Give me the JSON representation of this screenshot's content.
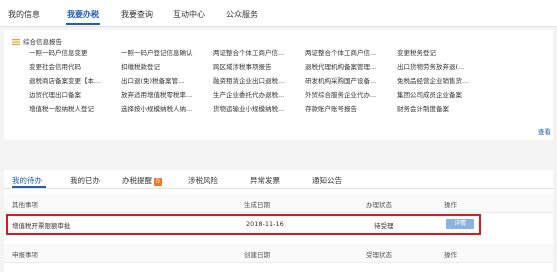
{
  "topnav": {
    "tabs": [
      "我的信息",
      "我要办税",
      "我要查询",
      "互动中心",
      "公众服务"
    ]
  },
  "report": {
    "title": "综合信息报告",
    "links": [
      [
        "一照一码户信息变更",
        "一照一码户登记信息确认",
        "两证整合个体工商户信...",
        "两证整合个体工商户信...",
        "变更税务登记"
      ],
      [
        "变更社会信用代码",
        "扣缴税款登记",
        "跨区域涉税事项报告",
        "退税代理机构备案管理...",
        "出口货物劳务放弃退(..."
      ],
      [
        "退税商店备案变更【本...",
        "出口退(免)税备案管...",
        "融资租赁企业出口退税...",
        "研发机构采购国产设备...",
        "免税品经营企业销售货..."
      ],
      [
        "边贸代理出口备案",
        "放弃适用增值税零税率...",
        "生产企业委托代办退税...",
        "外贸综合服务企业代办...",
        "集团公司成员企业备案"
      ],
      [
        "增值税一般纳税人登记",
        "选择按小规模纳税人纳...",
        "货物运输业小规模纳税...",
        "存款账户账号报告",
        "财务会计制度备案"
      ]
    ],
    "more": "查看"
  },
  "tasks": {
    "tabs": [
      "我的待办",
      "我的已办",
      "办税提醒",
      "涉税风险",
      "异常发票",
      "通知公告"
    ],
    "reminder_badge": "0",
    "headers1": [
      "其他事项",
      "生成日期",
      "办理状态",
      "操作"
    ],
    "row": {
      "item": "增值税开票限额审批",
      "date": "2018-11-16",
      "status": "待受理",
      "action": "详情"
    },
    "headers2": [
      "申报事项",
      "创建日期",
      "受理状态",
      "操作"
    ]
  }
}
